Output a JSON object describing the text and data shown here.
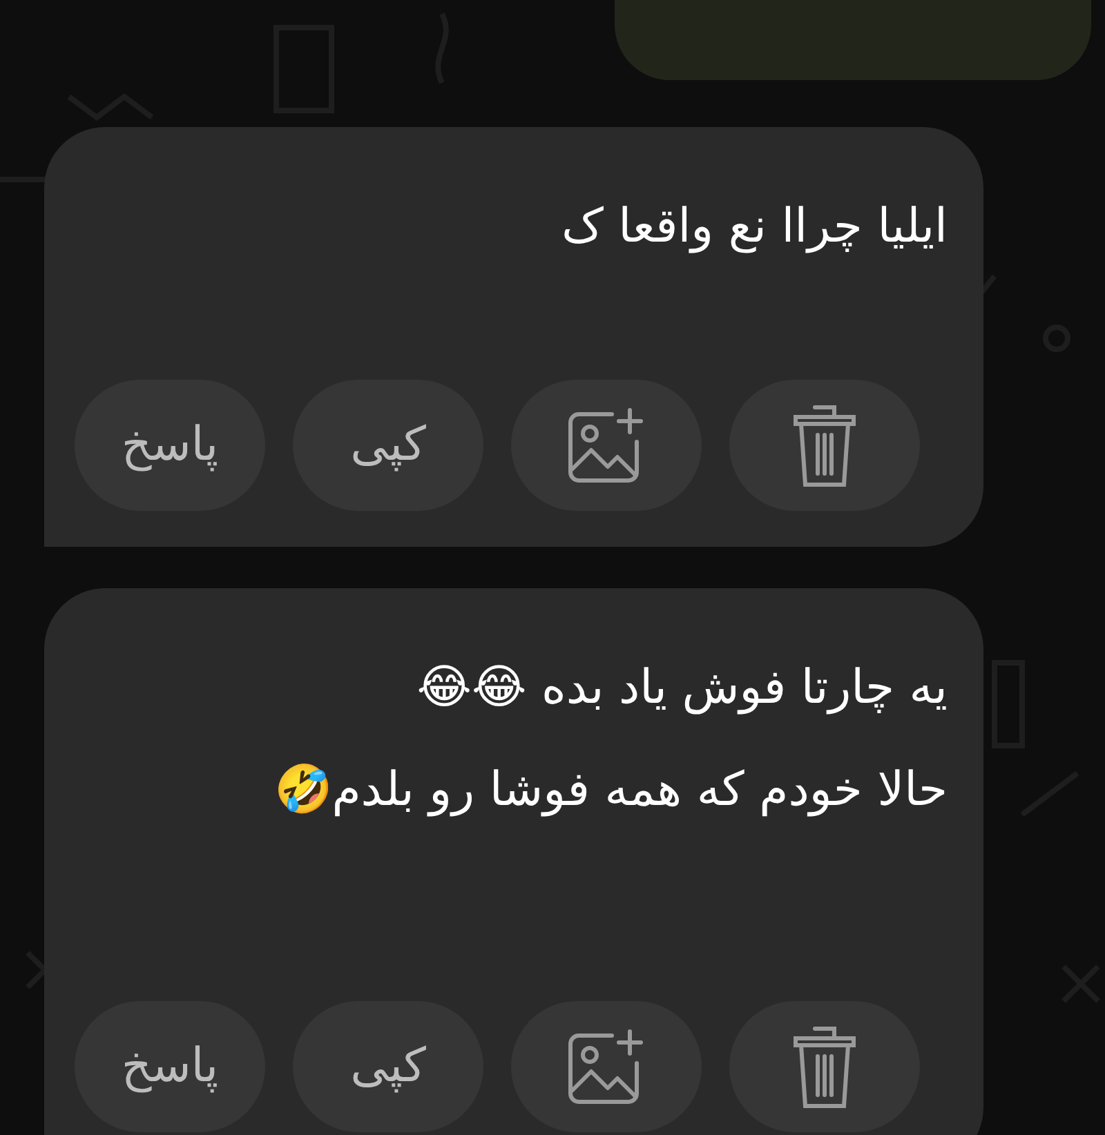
{
  "messages": [
    {
      "lines": [
        "ایلیا چراا نع واقعا ک"
      ],
      "actions": [
        {
          "kind": "delete"
        },
        {
          "kind": "add-image"
        },
        {
          "kind": "text",
          "label": "کپی"
        },
        {
          "kind": "text",
          "label": "پاسخ"
        }
      ]
    },
    {
      "lines": [
        "یه چارتا فوش یاد بده 😂😂",
        "حالا خودم که همه فوشا رو بلدم🤣"
      ],
      "actions": [
        {
          "kind": "delete"
        },
        {
          "kind": "add-image"
        },
        {
          "kind": "text",
          "label": "کپی"
        },
        {
          "kind": "text",
          "label": "پاسخ"
        }
      ]
    }
  ]
}
